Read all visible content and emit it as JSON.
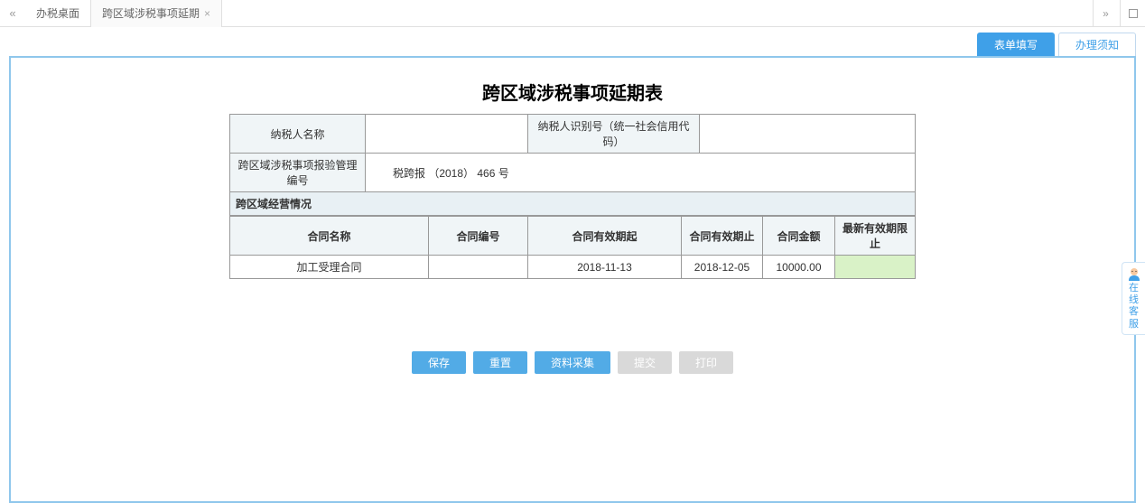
{
  "tabs": {
    "nav_left_icon": "«",
    "nav_right_icon": "»",
    "items": [
      {
        "label": "办税桌面",
        "closeable": false
      },
      {
        "label": "跨区域涉税事项延期",
        "closeable": true
      }
    ]
  },
  "sub_tabs": {
    "fill": "表单填写",
    "notice": "办理须知"
  },
  "form": {
    "title": "跨区域涉税事项延期表",
    "taxpayer_name_label": "纳税人名称",
    "taxpayer_name_value": "",
    "taxpayer_id_label": "纳税人识别号（统一社会信用代码）",
    "taxpayer_id_value": "",
    "cross_region_no_label": "跨区域涉税事项报验管理编号",
    "cross_region_no_value": "税跨报 （2018） 466 号",
    "section_header": "跨区域经营情况",
    "grid": {
      "headers": {
        "contract_name": "合同名称",
        "contract_no": "合同编号",
        "valid_start": "合同有效期起",
        "valid_end": "合同有效期止",
        "amount": "合同金额",
        "latest_end": "最新有效期限止"
      },
      "rows": [
        {
          "contract_name": "加工受理合同",
          "contract_no": "",
          "valid_start": "2018-11-13",
          "valid_end": "2018-12-05",
          "amount": "10000.00",
          "latest_end": ""
        }
      ]
    }
  },
  "buttons": {
    "save": "保存",
    "reset": "重置",
    "collect": "资料采集",
    "submit": "提交",
    "print": "打印"
  },
  "help": {
    "label": "在线客服"
  }
}
